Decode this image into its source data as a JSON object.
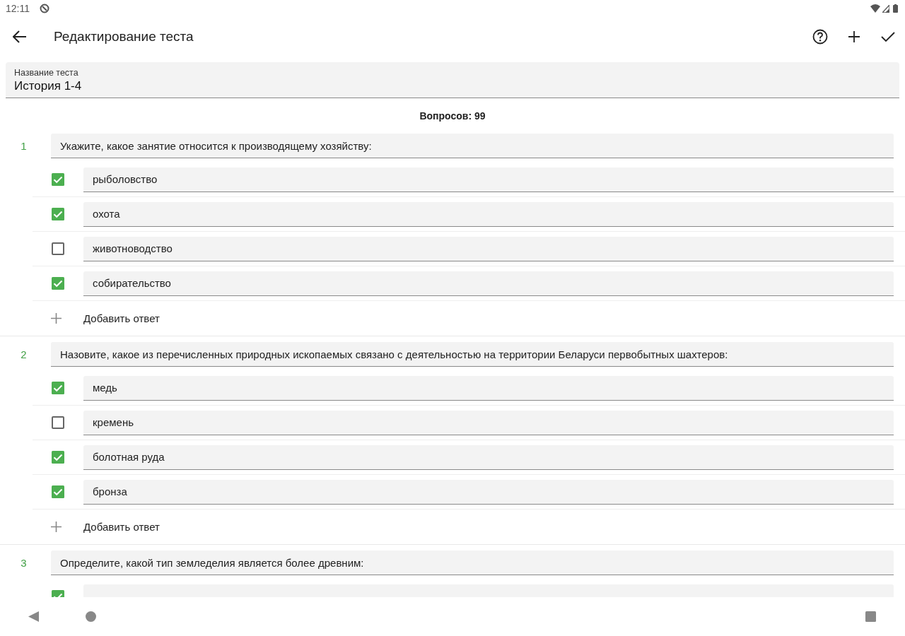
{
  "status_bar": {
    "time": "12:11"
  },
  "app_bar": {
    "title": "Редактирование теста"
  },
  "name_field": {
    "label": "Название теста",
    "value": "История 1-4"
  },
  "question_count": "Вопросов: 99",
  "questions": [
    {
      "number": "1",
      "text": "Укажите, какое занятие относится к производящему хозяйству:",
      "add_label": "Добавить ответ",
      "answers": [
        {
          "text": "рыболовство",
          "checked": true
        },
        {
          "text": "охота",
          "checked": true
        },
        {
          "text": "животноводство",
          "checked": false
        },
        {
          "text": "собирательство",
          "checked": true
        }
      ]
    },
    {
      "number": "2",
      "text": "Назовите, какое из перечисленных природных ископаемых связано с деятельностью на территории Беларуси первобытных шахтеров:",
      "add_label": "Добавить ответ",
      "answers": [
        {
          "text": "медь",
          "checked": true
        },
        {
          "text": "кремень",
          "checked": false
        },
        {
          "text": "болотная руда",
          "checked": true
        },
        {
          "text": "бронза",
          "checked": true
        }
      ]
    },
    {
      "number": "3",
      "text": "Определите, какой тип земледелия является более древним:",
      "answers": [
        {
          "checked": true
        }
      ]
    }
  ]
}
